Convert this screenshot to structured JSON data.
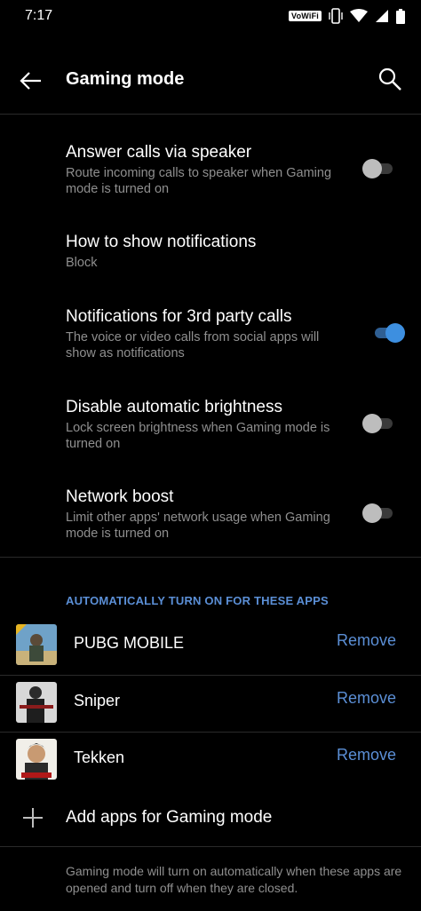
{
  "status_bar": {
    "time": "7:17",
    "network_badge": "VoWiFi"
  },
  "header": {
    "title": "Gaming mode"
  },
  "settings": [
    {
      "title": "Answer calls via speaker",
      "subtitle": "Route incoming calls to speaker when Gaming mode is turned on",
      "enabled": false
    },
    {
      "title": "How to show notifications",
      "subtitle": "Block"
    },
    {
      "title": "Notifications for 3rd party calls",
      "subtitle": "The voice or video calls from social apps will show as notifications",
      "enabled": true
    },
    {
      "title": "Disable automatic brightness",
      "subtitle": "Lock screen brightness when Gaming mode is turned on",
      "enabled": false
    },
    {
      "title": "Network boost",
      "subtitle": "Limit other apps' network usage when Gaming mode is turned on",
      "enabled": false
    }
  ],
  "apps_section": {
    "header": "AUTOMATICALLY TURN ON FOR THESE APPS",
    "apps": [
      {
        "name": "PUBG MOBILE",
        "action": "Remove"
      },
      {
        "name": "Sniper",
        "action": "Remove"
      },
      {
        "name": "Tekken",
        "action": "Remove"
      }
    ],
    "add_label": "Add apps for Gaming mode",
    "footer": "Gaming mode will turn on automatically when these apps are opened and turn off when they are closed."
  },
  "colors": {
    "accent": "#5b8fd6",
    "toggle_on": "#3d8fe0",
    "background": "#000000"
  }
}
